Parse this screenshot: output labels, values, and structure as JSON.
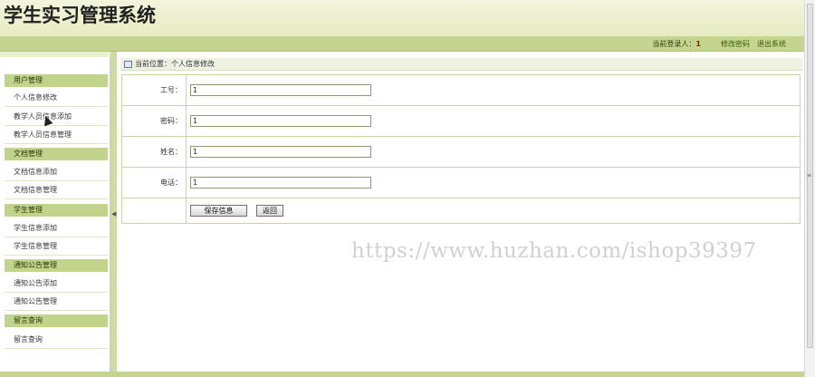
{
  "app": {
    "title": "学生实习管理系统"
  },
  "topbar": {
    "login_label": "当前登录人：",
    "login_user": "1",
    "change_password": "修改密码",
    "logout": "退出系统"
  },
  "sidebar": {
    "groups": [
      {
        "title": "用户管理",
        "items": [
          "个人信息修改",
          "教学人员信息添加",
          "教学人员信息管理"
        ]
      },
      {
        "title": "文档管理",
        "items": [
          "文档信息添加",
          "文档信息管理"
        ]
      },
      {
        "title": "学生管理",
        "items": [
          "学生信息添加",
          "学生信息管理"
        ]
      },
      {
        "title": "通知公告管理",
        "items": [
          "通知公告添加",
          "通知公告管理"
        ]
      },
      {
        "title": "留言查询",
        "items": [
          "留言查询"
        ]
      }
    ]
  },
  "breadcrumb": {
    "text": "当前位置：个人信息修改"
  },
  "form": {
    "fields": [
      {
        "label": "工号：",
        "value": "1"
      },
      {
        "label": "密码：",
        "value": "1"
      },
      {
        "label": "姓名：",
        "value": "1"
      },
      {
        "label": "电话：",
        "value": "1"
      }
    ],
    "save_label": "保存信息",
    "back_label": "返回"
  },
  "watermark": "https://www.huzhan.com/ishop39397",
  "icons": {
    "splitter": "triangle-left-icon",
    "crumb": "window-icon"
  },
  "colors": {
    "accent": "#c5d48e",
    "banner": "#e6ecc1",
    "highlight": "#c00000"
  }
}
